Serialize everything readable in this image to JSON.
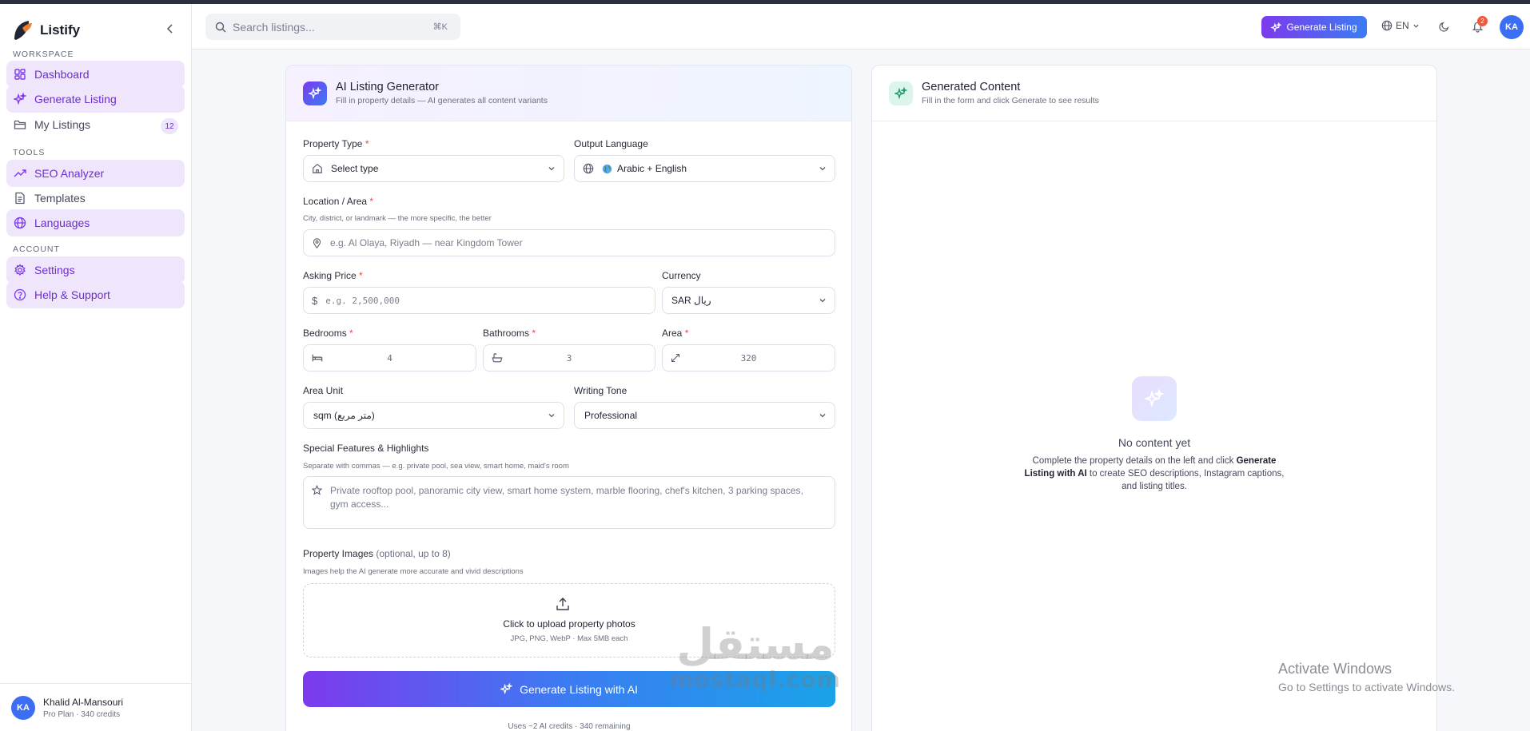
{
  "app": {
    "name": "Listify",
    "brand_color": "#7c3aed",
    "accent_blue": "#3b7cf2"
  },
  "sidebar": {
    "sections": [
      {
        "title": "WORKSPACE"
      },
      {
        "title": "TOOLS"
      },
      {
        "title": "ACCOUNT"
      }
    ],
    "items": [
      {
        "label": "Dashboard",
        "icon": "grid-icon",
        "active": true
      },
      {
        "label": "Generate Listing",
        "icon": "sparkles-icon",
        "active": true
      },
      {
        "label": "My Listings",
        "icon": "folder-icon",
        "badge": "12"
      },
      {
        "label": "SEO Analyzer",
        "icon": "trending-up-icon",
        "active": true
      },
      {
        "label": "Templates",
        "icon": "document-icon"
      },
      {
        "label": "Languages",
        "icon": "globe-icon",
        "active": true
      },
      {
        "label": "Settings",
        "icon": "gear-icon",
        "active": true
      },
      {
        "label": "Help & Support",
        "icon": "help-circle-icon",
        "active": true
      }
    ],
    "user": {
      "initials": "KA",
      "name": "Khalid Al-Mansouri",
      "plan": "Pro Plan · 340 credits"
    }
  },
  "header": {
    "search_placeholder": "Search listings...",
    "search_shortcut": "⌘K",
    "generate_button": "Generate Listing",
    "language": "EN",
    "notification_count": "2",
    "avatar_initials": "KA"
  },
  "form": {
    "title": "AI Listing Generator",
    "subtitle": "Fill in property details — AI generates all content variants",
    "property_type": {
      "label": "Property Type",
      "value": "Select type"
    },
    "output_language": {
      "label": "Output Language",
      "value": "Arabic + English"
    },
    "location": {
      "label": "Location / Area",
      "help": "City, district, or landmark — the more specific, the better",
      "placeholder": "e.g. Al Olaya, Riyadh — near Kingdom Tower"
    },
    "price": {
      "label": "Asking Price",
      "placeholder": "e.g. 2,500,000"
    },
    "currency": {
      "label": "Currency",
      "value": "SAR ريال"
    },
    "bedrooms": {
      "label": "Bedrooms",
      "placeholder": "4"
    },
    "bathrooms": {
      "label": "Bathrooms",
      "placeholder": "3"
    },
    "area": {
      "label": "Area",
      "placeholder": "320"
    },
    "area_unit": {
      "label": "Area Unit",
      "value": "sqm (متر مربع)"
    },
    "tone": {
      "label": "Writing Tone",
      "value": "Professional"
    },
    "features": {
      "label": "Special Features & Highlights",
      "help": "Separate with commas — e.g. private pool, sea view, smart home, maid's room",
      "placeholder": "Private rooftop pool, panoramic city view, smart home system, marble flooring, chef's kitchen, 3 parking spaces, gym access..."
    },
    "images": {
      "label": "Property Images",
      "label_note": "(optional, up to 8)",
      "help": "Images help the AI generate more accurate and vivid descriptions",
      "upload_title": "Click to upload property photos",
      "upload_sub": "JPG, PNG, WebP · Max 5MB each"
    },
    "submit_label": "Generate Listing with AI",
    "credits_note": "Uses ~2 AI credits · 340 remaining"
  },
  "results": {
    "title": "Generated Content",
    "subtitle": "Fill in the form and click Generate to see results",
    "empty_title": "No content yet",
    "empty_desc_pre": "Complete the property details on the left and click ",
    "empty_desc_bold": "Generate Listing with AI",
    "empty_desc_post": " to create SEO descriptions, Instagram captions, and listing titles."
  },
  "watermark": {
    "arabic": "مستقل",
    "latin": "mostaql.com"
  },
  "os_overlay": {
    "line1": "Activate Windows",
    "line2": "Go to Settings to activate Windows."
  }
}
